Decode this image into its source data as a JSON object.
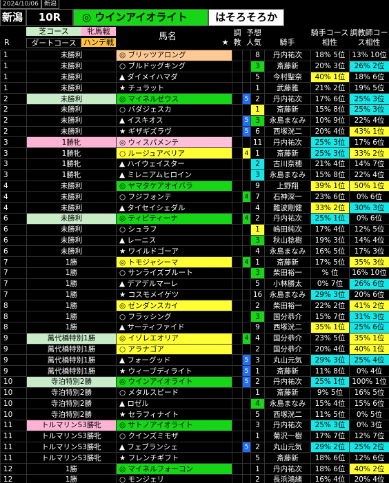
{
  "topbar": {
    "date": "2024/10/06",
    "venue": "新潟"
  },
  "title": {
    "venue": "新潟",
    "race": "10R",
    "horse": "◎ ウインアイオライト",
    "sire": "はそろそろか"
  },
  "headers": {
    "turf": "芝コース",
    "dirt": "ダートコース",
    "filly": "牝馬戦",
    "handicap": "ハンデ戦",
    "r": "R",
    "horse": "馬名",
    "star": "★",
    "adjust": "調教",
    "odds": "予想人気",
    "jockey": "騎手",
    "jockey_stats": "騎手コース相性",
    "trainer_stats": "調教師コース相性"
  },
  "colors": {
    "accent_green": "#17d617",
    "turf": "#c8ecc8",
    "pink": "#ffb3d4",
    "yellow": "#ffff33",
    "cyan": "#17e6e6"
  },
  "rows": [
    {
      "r": "1",
      "cls": "未勝利",
      "clsbg": "",
      "mark": "◎",
      "horse": "ブリッツアロング",
      "hbg": "b",
      "adj": "",
      "adjbg": "",
      "odds": "8",
      "oddsbg": "",
      "jockey": "丹内祐次",
      "js": "18% 5位",
      "jsbg": "",
      "ts": "13% 10位",
      "tsbg": ""
    },
    {
      "r": "1",
      "cls": "未勝利",
      "clsbg": "",
      "mark": "○",
      "horse": "ブルドッグキング",
      "hbg": "",
      "adj": "",
      "adjbg": "",
      "odds": "3",
      "oddsbg": "g",
      "jockey": "斎藤新",
      "js": "20% 3位",
      "jsbg": "",
      "ts": "26% 2位",
      "tsbg": "c"
    },
    {
      "r": "1",
      "cls": "未勝利",
      "clsbg": "",
      "mark": "▲",
      "horse": "ダイメイハマダ",
      "hbg": "",
      "adj": "",
      "adjbg": "",
      "odds": "5",
      "oddsbg": "",
      "jockey": "今村聖奈",
      "js": "40% 1位",
      "jsbg": "y",
      "ts": "18% 6位",
      "tsbg": ""
    },
    {
      "r": "1",
      "cls": "未勝利",
      "clsbg": "",
      "mark": "★",
      "horse": "チュラット",
      "hbg": "",
      "adj": "",
      "adjbg": "",
      "odds": "1",
      "oddsbg": "",
      "jockey": "武藤雅",
      "js": "21% 2位",
      "jsbg": "",
      "ts": "19% 5位",
      "tsbg": ""
    },
    {
      "r": "2",
      "cls": "未勝利",
      "clsbg": "g",
      "mark": "◎",
      "horse": "マイネルゼウス",
      "hbg": "g",
      "adj": "5",
      "adjbg": "b",
      "odds": "2",
      "oddsbg": "",
      "jockey": "丹内祐次",
      "js": "17% 6位",
      "jsbg": "",
      "ts": "25% 3位",
      "tsbg": "c"
    },
    {
      "r": "2",
      "cls": "未勝利",
      "clsbg": "",
      "mark": "○",
      "horse": "バダジェスカ",
      "hbg": "",
      "adj": "",
      "adjbg": "",
      "odds": "1",
      "oddsbg": "y",
      "jockey": "斎藤新",
      "js": "15% 8位",
      "jsbg": "",
      "ts": "25% 3位",
      "tsbg": "c"
    },
    {
      "r": "2",
      "cls": "未勝利",
      "clsbg": "",
      "mark": "▲",
      "horse": "イスキオス",
      "hbg": "",
      "adj": "5",
      "adjbg": "b",
      "odds": "3",
      "oddsbg": "g",
      "jockey": "永島まなみ",
      "js": "10% 9位",
      "jsbg": "",
      "ts": "22% 4位",
      "tsbg": ""
    },
    {
      "r": "2",
      "cls": "未勝利",
      "clsbg": "",
      "mark": "★",
      "horse": "ギザギズラヴ",
      "hbg": "",
      "adj": "5",
      "adjbg": "b",
      "odds": "6",
      "oddsbg": "",
      "jockey": "西塚洸二",
      "js": "20% 4位",
      "jsbg": "",
      "ts": "43% 1位",
      "tsbg": "y"
    },
    {
      "r": "3",
      "cls": "1勝牝",
      "clsbg": "p",
      "mark": "◎",
      "horse": "ウィスパメンテ",
      "hbg": "p",
      "adj": "",
      "adjbg": "",
      "odds": "11",
      "oddsbg": "",
      "jockey": "丹内祐次",
      "js": "25% 3位",
      "jsbg": "c",
      "ts": "17% 6位",
      "tsbg": ""
    },
    {
      "r": "3",
      "cls": "1勝牝",
      "clsbg": "",
      "mark": "○",
      "horse": "ルージュアベリア",
      "hbg": "y",
      "adj": "4",
      "adjbg": "y",
      "odds": "1",
      "oddsbg": "",
      "jockey": "斎藤新",
      "js": "25% 3位",
      "jsbg": "c",
      "ts": "33% 2位",
      "tsbg": "y"
    },
    {
      "r": "3",
      "cls": "1勝牝",
      "clsbg": "",
      "mark": "▲",
      "horse": "ハイウェイスター",
      "hbg": "",
      "adj": "",
      "adjbg": "",
      "odds": "2",
      "oddsbg": "c",
      "jockey": "古川奈穂",
      "js": "21% 4位",
      "jsbg": "",
      "ts": "14% 7位",
      "tsbg": ""
    },
    {
      "r": "3",
      "cls": "1勝牝",
      "clsbg": "",
      "mark": "▲",
      "horse": "ミレニアムヒロイン",
      "hbg": "",
      "adj": "",
      "adjbg": "",
      "odds": "3",
      "oddsbg": "c",
      "jockey": "永島まなみ",
      "js": "15% 8位",
      "jsbg": "",
      "ts": "22% 4位",
      "tsbg": ""
    },
    {
      "r": "4",
      "cls": "未勝利",
      "clsbg": "",
      "mark": "◎",
      "horse": "ヤマタケアオイバラ",
      "hbg": "g",
      "adj": "",
      "adjbg": "",
      "odds": "9",
      "oddsbg": "",
      "jockey": "上野翔",
      "js": "39% 1位",
      "jsbg": "y",
      "ts": "50% 1位",
      "tsbg": "y"
    },
    {
      "r": "4",
      "cls": "未勝利",
      "clsbg": "",
      "mark": "○",
      "horse": "フジフォンテ",
      "hbg": "",
      "adj": "4",
      "adjbg": "g",
      "odds": "7",
      "oddsbg": "",
      "jockey": "石神深一",
      "js": "23% 6位",
      "jsbg": "",
      "ts": "0% 6位",
      "tsbg": ""
    },
    {
      "r": "4",
      "cls": "未勝利",
      "clsbg": "",
      "mark": "▲",
      "horse": "タイセイシェダル",
      "hbg": "",
      "adj": "",
      "adjbg": "",
      "odds": "4",
      "oddsbg": "",
      "jockey": "難波剛健",
      "js": "33% 2位",
      "jsbg": "y",
      "ts": "30% 3位",
      "tsbg": "c"
    },
    {
      "r": "6",
      "cls": "未勝利",
      "clsbg": "g",
      "mark": "◎",
      "horse": "ティピティーナ",
      "hbg": "g",
      "adj": "4",
      "adjbg": "g",
      "odds": "2",
      "oddsbg": "",
      "jockey": "丹内祐次",
      "js": "25% 1位",
      "jsbg": "c",
      "ts": "0% 6位",
      "tsbg": ""
    },
    {
      "r": "6",
      "cls": "未勝利",
      "clsbg": "",
      "mark": "○",
      "horse": "シュラフ",
      "hbg": "",
      "adj": "",
      "adjbg": "",
      "odds": "1",
      "oddsbg": "y",
      "jockey": "嶋田純次",
      "js": "17% 4位",
      "jsbg": "",
      "ts": "12% 5位",
      "tsbg": ""
    },
    {
      "r": "6",
      "cls": "未勝利",
      "clsbg": "",
      "mark": "▲",
      "horse": "レーニス",
      "hbg": "",
      "adj": "",
      "adjbg": "",
      "odds": "3",
      "oddsbg": "g",
      "jockey": "秋山稔樹",
      "js": "19% 3位",
      "jsbg": "",
      "ts": "14% 4位",
      "tsbg": ""
    },
    {
      "r": "6",
      "cls": "未勝利",
      "clsbg": "",
      "mark": "★",
      "horse": "ワイルドゴーア",
      "hbg": "",
      "adj": "",
      "adjbg": "",
      "odds": "4",
      "oddsbg": "",
      "jockey": "永島まなみ",
      "js": "16% 5位",
      "jsbg": "",
      "ts": "17% 3位",
      "tsbg": ""
    },
    {
      "r": "7",
      "cls": "1勝",
      "clsbg": "",
      "mark": "◎",
      "horse": "トモジャシーマ",
      "hbg": "y",
      "adj": "4",
      "adjbg": "g",
      "odds": "1",
      "oddsbg": "",
      "jockey": "斎藤新",
      "js": "17% 5位",
      "jsbg": "",
      "ts": "35% 3位",
      "tsbg": "y"
    },
    {
      "r": "7",
      "cls": "1勝",
      "clsbg": "",
      "mark": "○",
      "horse": "サンライズブルート",
      "hbg": "",
      "adj": "",
      "adjbg": "",
      "odds": "3",
      "oddsbg": "g",
      "jockey": "柴田裕一",
      "js": "% 位",
      "jsbg": "",
      "ts": "16% 10位",
      "tsbg": ""
    },
    {
      "r": "7",
      "cls": "1勝",
      "clsbg": "",
      "mark": "▲",
      "horse": "デアデルマーレ",
      "hbg": "",
      "adj": "",
      "adjbg": "",
      "odds": "5",
      "oddsbg": "",
      "jockey": "小林勝太",
      "js": "0% 7位",
      "jsbg": "",
      "ts": "26% 6位",
      "tsbg": "c"
    },
    {
      "r": "7",
      "cls": "1勝",
      "clsbg": "",
      "mark": "★",
      "horse": "コスモメイゲツ",
      "hbg": "",
      "adj": "",
      "adjbg": "",
      "odds": "16",
      "oddsbg": "",
      "jockey": "永島まなみ",
      "js": "29% 3位",
      "jsbg": "c",
      "ts": "20% 6位",
      "tsbg": ""
    },
    {
      "r": "8",
      "cls": "1勝",
      "clsbg": "",
      "mark": "◎",
      "horse": "ゼンダンスカイ",
      "hbg": "y",
      "adj": "",
      "adjbg": "",
      "odds": "2",
      "oddsbg": "",
      "jockey": "柴田裕一",
      "js": "22% 2位",
      "jsbg": "",
      "ts": "41% 2位",
      "tsbg": "y"
    },
    {
      "r": "8",
      "cls": "1勝",
      "clsbg": "",
      "mark": "○",
      "horse": "フラッシング",
      "hbg": "",
      "adj": "",
      "adjbg": "",
      "odds": "3",
      "oddsbg": "g",
      "jockey": "国分恭介",
      "js": "15% 7位",
      "jsbg": "",
      "ts": "31% 3位",
      "tsbg": "c"
    },
    {
      "r": "8",
      "cls": "1勝",
      "clsbg": "",
      "mark": "▲",
      "horse": "サーティファイド",
      "hbg": "",
      "adj": "",
      "adjbg": "",
      "odds": "9",
      "oddsbg": "",
      "jockey": "西塚洸二",
      "js": "35% 1位",
      "jsbg": "y",
      "ts": "25% 6位",
      "tsbg": "c"
    },
    {
      "r": "9",
      "cls": "萬代橋特別1勝",
      "clsbg": "g",
      "mark": "◎",
      "horse": "イゾレエオリア",
      "hbg": "y",
      "adj": "4",
      "adjbg": "g",
      "odds": "4",
      "oddsbg": "",
      "jockey": "国分恭介",
      "js": "23% 5位",
      "jsbg": "",
      "ts": "35% 1位",
      "tsbg": "y"
    },
    {
      "r": "9",
      "cls": "萬代橋特別1勝",
      "clsbg": "",
      "mark": "○",
      "horse": "アラナゴア",
      "hbg": "y",
      "adj": "",
      "adjbg": "",
      "odds": "2",
      "oddsbg": "",
      "jockey": "国分恭介",
      "js": "20% 4位",
      "jsbg": "",
      "ts": "40% 1位",
      "tsbg": "y"
    },
    {
      "r": "9",
      "cls": "萬代橋特別1勝",
      "clsbg": "",
      "mark": "▲",
      "horse": "フォーグッド",
      "hbg": "",
      "adj": "5",
      "adjbg": "b",
      "odds": "3",
      "oddsbg": "",
      "jockey": "丸山元気",
      "js": "29% 3位",
      "jsbg": "c",
      "ts": "25% 4位",
      "tsbg": "c"
    },
    {
      "r": "9",
      "cls": "萬代橋特別1勝",
      "clsbg": "",
      "mark": "★",
      "horse": "ウィーブディライト",
      "hbg": "",
      "adj": "5",
      "adjbg": "b",
      "odds": "1",
      "oddsbg": "",
      "jockey": "斎藤新",
      "js": "11% 8位",
      "jsbg": "",
      "ts": "0% 4位",
      "tsbg": ""
    },
    {
      "r": "10",
      "cls": "寺泊特別2勝",
      "clsbg": "g",
      "mark": "◎",
      "horse": "ウインアイオライト",
      "hbg": "g",
      "adj": "5",
      "adjbg": "b",
      "odds": "2",
      "oddsbg": "",
      "jockey": "丹内祐次",
      "js": "25% 1位",
      "jsbg": "c",
      "ts": "100% 1位",
      "tsbg": ""
    },
    {
      "r": "10",
      "cls": "寺泊特別2勝",
      "clsbg": "",
      "mark": "○",
      "horse": "メタルスピード",
      "hbg": "",
      "adj": "",
      "adjbg": "",
      "odds": "1",
      "oddsbg": "",
      "jockey": "斎藤新",
      "js": "9% 5位",
      "jsbg": "",
      "ts": "16% 5位",
      "tsbg": ""
    },
    {
      "r": "10",
      "cls": "寺泊特別2勝",
      "clsbg": "",
      "mark": "▲",
      "horse": "ロゼル",
      "hbg": "",
      "adj": "",
      "adjbg": "",
      "odds": "4",
      "oddsbg": "g",
      "jockey": "永島まなみ",
      "js": "15% 4位",
      "jsbg": "",
      "ts": "15% 6位",
      "tsbg": ""
    },
    {
      "r": "10",
      "cls": "寺泊特別2勝",
      "clsbg": "",
      "mark": "★",
      "horse": "セラフィナイト",
      "hbg": "",
      "adj": "",
      "adjbg": "",
      "odds": "5",
      "oddsbg": "",
      "jockey": "西塚洸二",
      "js": "11% 5位",
      "jsbg": "",
      "ts": "0% 5位",
      "tsbg": ""
    },
    {
      "r": "11",
      "cls": "トルマリンS3勝牝",
      "clsbg": "p",
      "mark": "◎",
      "horse": "サトノアイオライト",
      "hbg": "g",
      "adj": "",
      "adjbg": "",
      "odds": "3",
      "oddsbg": "",
      "jockey": "丹内祐次",
      "js": "25% 3位",
      "jsbg": "c",
      "ts": "0% 3位",
      "tsbg": ""
    },
    {
      "r": "11",
      "cls": "トルマリンS3勝牝",
      "clsbg": "",
      "mark": "○",
      "horse": "クインズミモザ",
      "hbg": "",
      "adj": "",
      "adjbg": "",
      "odds": "1",
      "oddsbg": "",
      "jockey": "菊沢一樹",
      "js": "17% 7位",
      "jsbg": "",
      "ts": "12% 7位",
      "tsbg": ""
    },
    {
      "r": "11",
      "cls": "トルマリンS3勝牝",
      "clsbg": "",
      "mark": "▲",
      "horse": "フェブランシェ",
      "hbg": "",
      "adj": "5",
      "adjbg": "b",
      "odds": "2",
      "oddsbg": "",
      "jockey": "丸山元気",
      "js": "29% 2位",
      "jsbg": "c",
      "ts": "25% 2位",
      "tsbg": "c"
    },
    {
      "r": "11",
      "cls": "トルマリンS3勝牝",
      "clsbg": "",
      "mark": "★",
      "horse": "フレンチギフト",
      "hbg": "",
      "adj": "",
      "adjbg": "",
      "odds": "5",
      "oddsbg": "",
      "jockey": "斎藤新",
      "js": "18% 6位",
      "jsbg": "",
      "ts": "12% 6位",
      "tsbg": ""
    },
    {
      "r": "12",
      "cls": "1勝",
      "clsbg": "",
      "mark": "◎",
      "horse": "マイネルフォーコン",
      "hbg": "g",
      "adj": "",
      "adjbg": "",
      "odds": "1",
      "oddsbg": "",
      "jockey": "丹内祐次",
      "js": "18% 6位",
      "jsbg": "",
      "ts": "40% 2位",
      "tsbg": "y"
    },
    {
      "r": "12",
      "cls": "1勝",
      "clsbg": "",
      "mark": "○",
      "horse": "モンジェリ",
      "hbg": "",
      "adj": "",
      "adjbg": "",
      "odds": "2",
      "oddsbg": "",
      "jockey": "長浜鴻緒",
      "js": "16% 4位",
      "jsbg": "",
      "ts": "20% 4位",
      "tsbg": ""
    },
    {
      "r": "12",
      "cls": "1勝",
      "clsbg": "",
      "mark": "▲",
      "horse": "スパークルジョイ",
      "hbg": "",
      "adj": "4",
      "adjbg": "g",
      "odds": "5",
      "oddsbg": "",
      "jockey": "斎藤新",
      "js": "14% 5位",
      "jsbg": "",
      "ts": "22% 3位",
      "tsbg": ""
    },
    {
      "r": "12",
      "cls": "1勝",
      "clsbg": "",
      "mark": "★",
      "horse": "イエデゴロゴロ",
      "hbg": "",
      "adj": "",
      "adjbg": "",
      "odds": "6",
      "oddsbg": "",
      "jockey": "永島まなみ",
      "js": "16% 7位",
      "jsbg": "",
      "ts": "9% 13位",
      "tsbg": ""
    }
  ]
}
